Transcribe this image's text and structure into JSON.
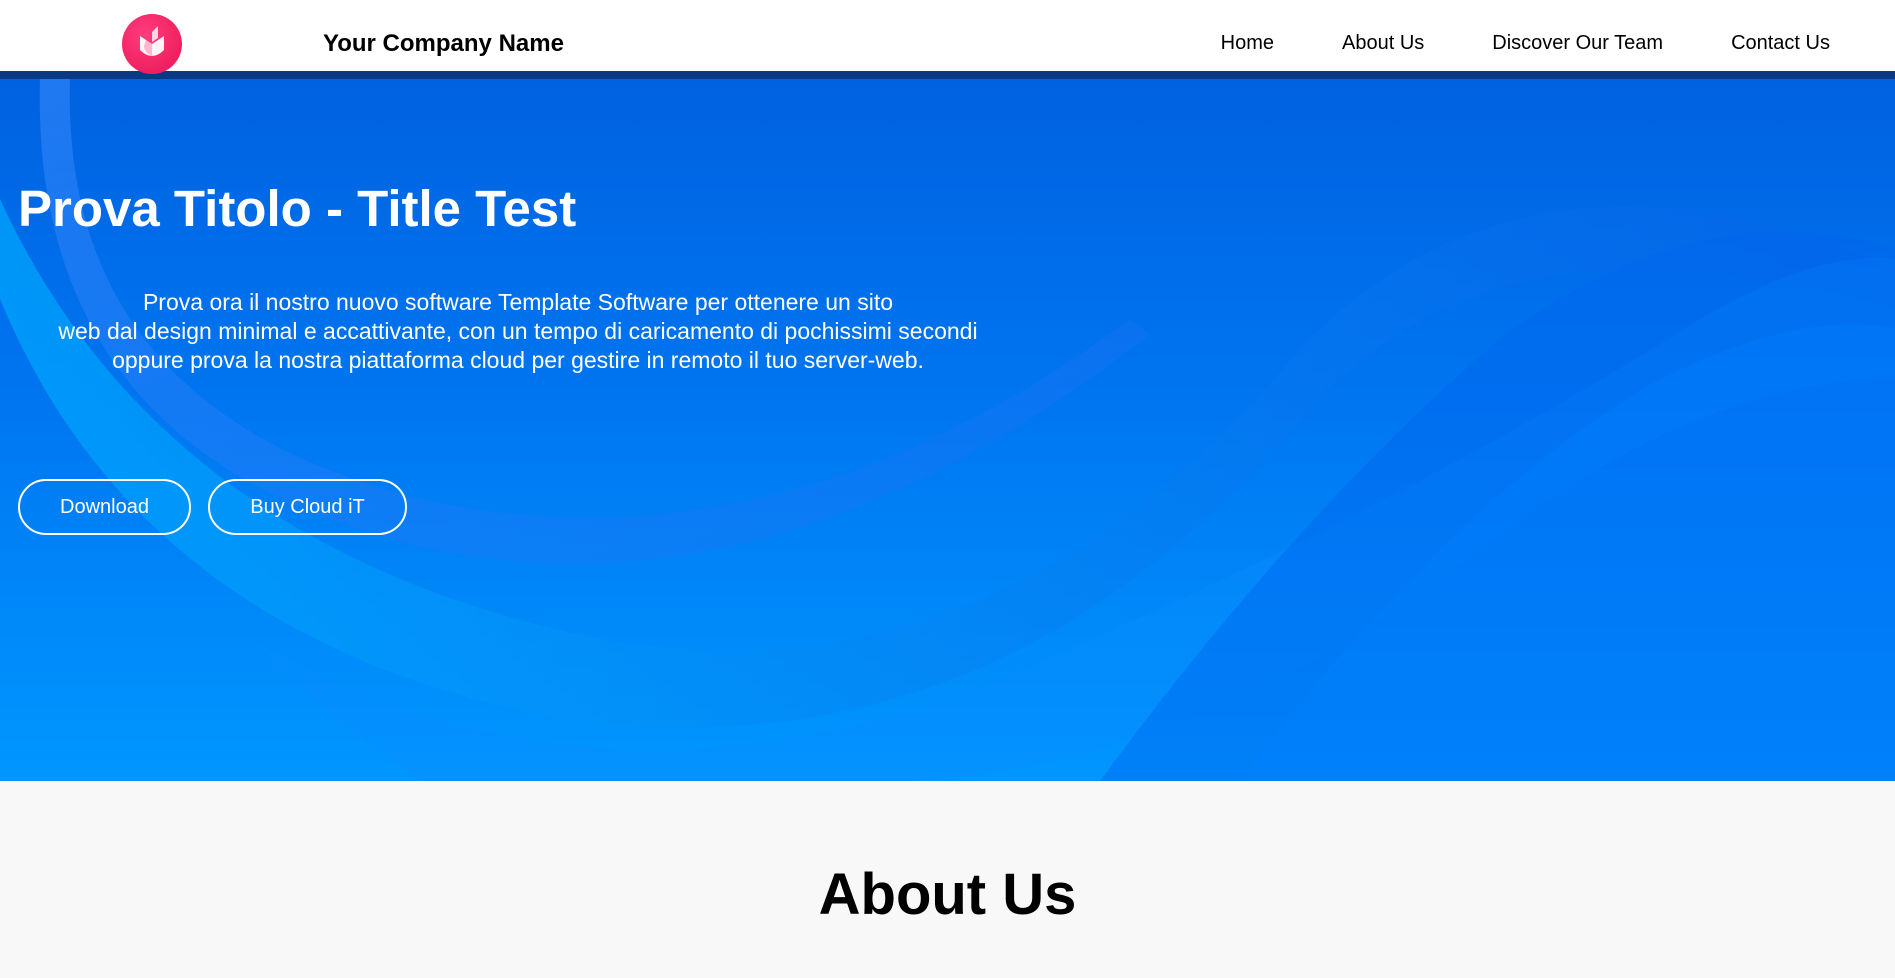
{
  "header": {
    "brand": "Your Company Name",
    "logo_icon": "heart-shield-logo",
    "nav": [
      {
        "label": "Home"
      },
      {
        "label": "About Us"
      },
      {
        "label": "Discover Our Team"
      },
      {
        "label": "Contact Us"
      }
    ]
  },
  "hero": {
    "title": "Prova Titolo - Title Test",
    "description": [
      "Prova ora il nostro nuovo software Template Software per ottenere un sito",
      "web dal design minimal e accattivante, con un tempo di caricamento di pochissimi secondi",
      "oppure prova la nostra piattaforma cloud per gestire in remoto il tuo server-web."
    ],
    "buttons": {
      "download": "Download",
      "buy": "Buy Cloud iT"
    }
  },
  "about": {
    "title": "About Us"
  },
  "colors": {
    "accent": "#f0205f",
    "hero_blue": "#0070ec",
    "nav_border": "#0a3a85"
  }
}
